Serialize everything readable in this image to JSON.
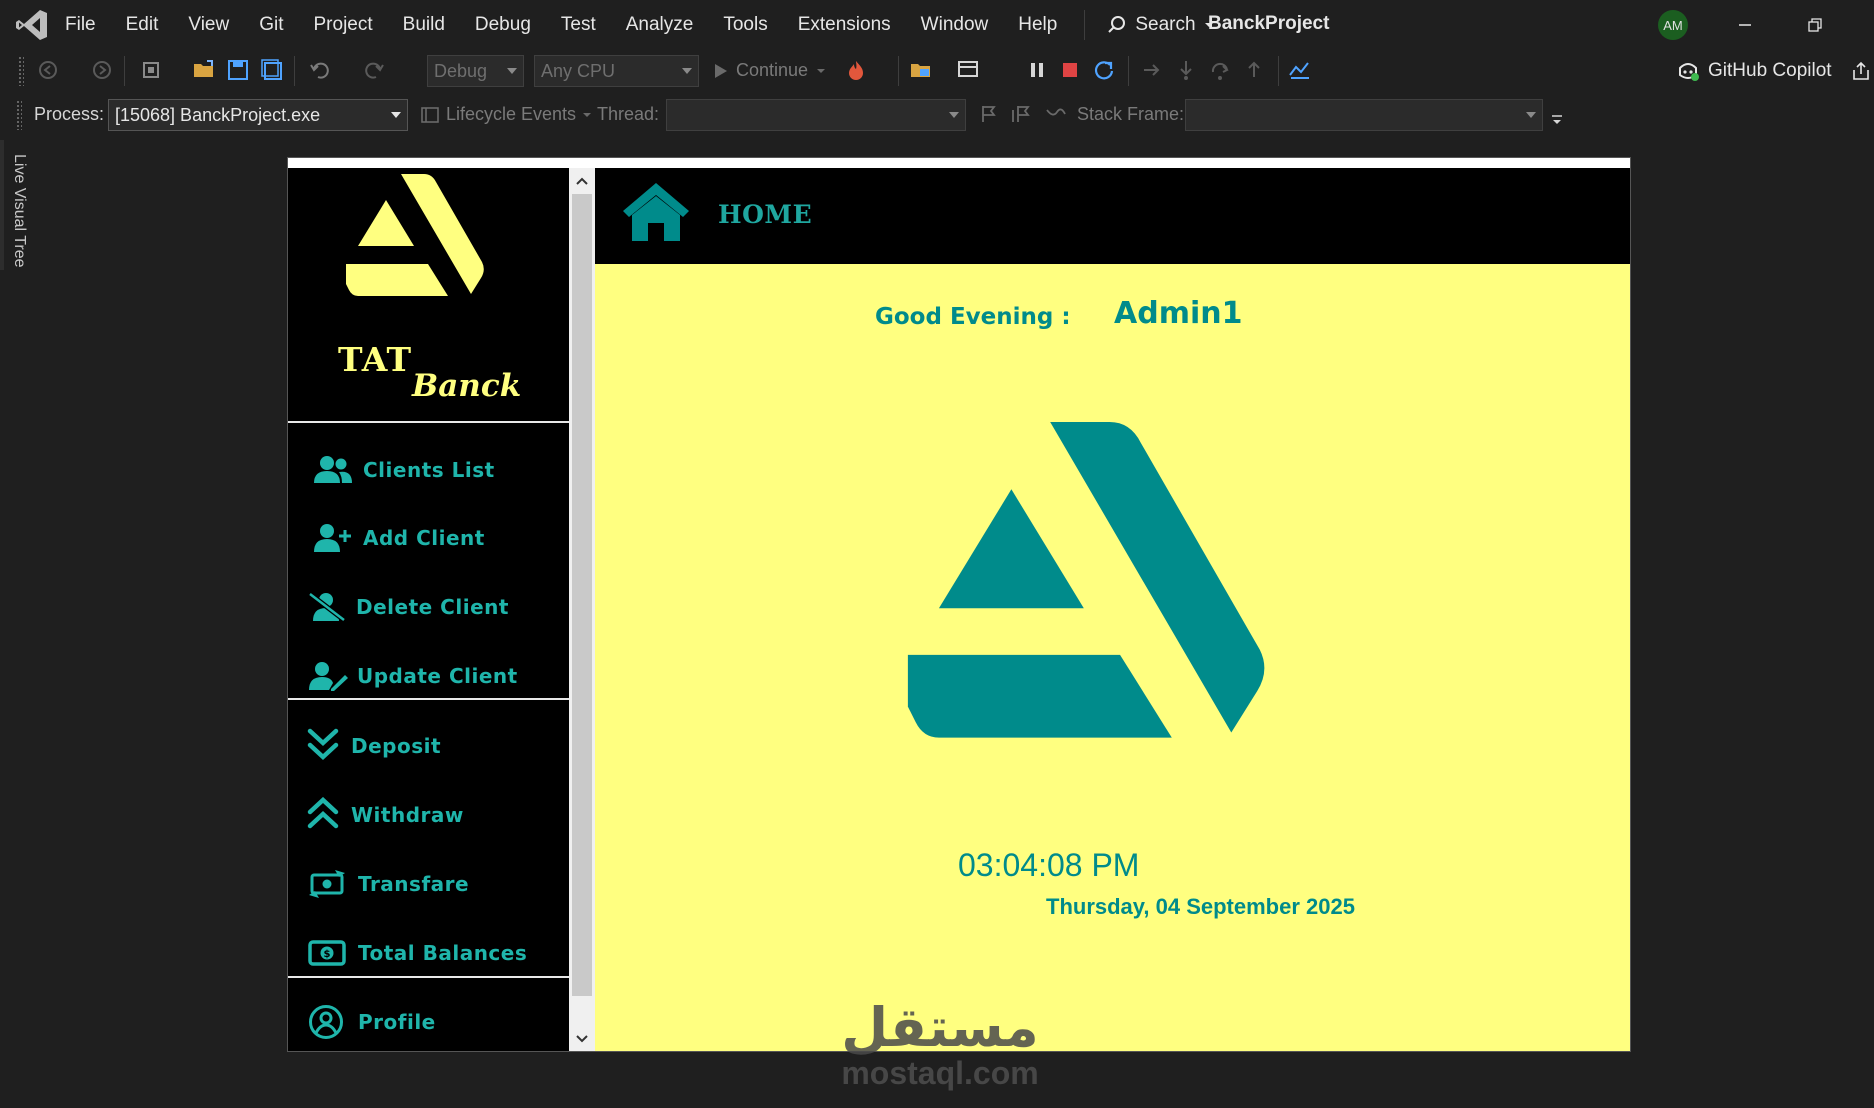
{
  "ide": {
    "menu": [
      "File",
      "Edit",
      "View",
      "Git",
      "Project",
      "Build",
      "Debug",
      "Test",
      "Analyze",
      "Tools",
      "Extensions",
      "Window",
      "Help"
    ],
    "search_label": "Search",
    "project_name": "BanckProject",
    "avatar_initials": "AM",
    "toolbar": {
      "config": "Debug",
      "platform": "Any CPU",
      "continue_label": "Continue",
      "copilot_label": "GitHub Copilot"
    },
    "debug_bar": {
      "process_label": "Process:",
      "process_value": "[15068] BanckProject.exe",
      "lifecycle_label": "Lifecycle Events",
      "thread_label": "Thread:",
      "stack_frame_label": "Stack Frame:"
    },
    "side_tab": "Live Visual Tree"
  },
  "app": {
    "brand_top": "TAT",
    "brand_bottom": "Banck",
    "header_title": "HOME",
    "greeting": "Good Evening :",
    "user_name": "Admin1",
    "time": "03:04:08 PM",
    "date": "Thursday, 04 September 2025",
    "nav": [
      {
        "label": "Clients List",
        "icon": "users-icon"
      },
      {
        "label": "Add Client",
        "icon": "user-plus-icon"
      },
      {
        "label": "Delete Client",
        "icon": "user-slash-icon"
      },
      {
        "label": "Update Client",
        "icon": "user-edit-icon"
      },
      {
        "label": "Deposit",
        "icon": "chevrons-down-icon"
      },
      {
        "label": "Withdraw",
        "icon": "chevrons-up-icon"
      },
      {
        "label": "Transfare",
        "icon": "money-transfer-icon"
      },
      {
        "label": "Total Balances",
        "icon": "money-bill-icon"
      },
      {
        "label": "Profile",
        "icon": "user-circle-icon"
      }
    ],
    "colors": {
      "accent": "#008b8b",
      "nav_text": "#1fb5ab",
      "brand_yellow": "#ffff80",
      "content_bg": "#ffff80"
    }
  },
  "watermark": {
    "arabic": "مستقل",
    "latin": "mostaql.com"
  }
}
